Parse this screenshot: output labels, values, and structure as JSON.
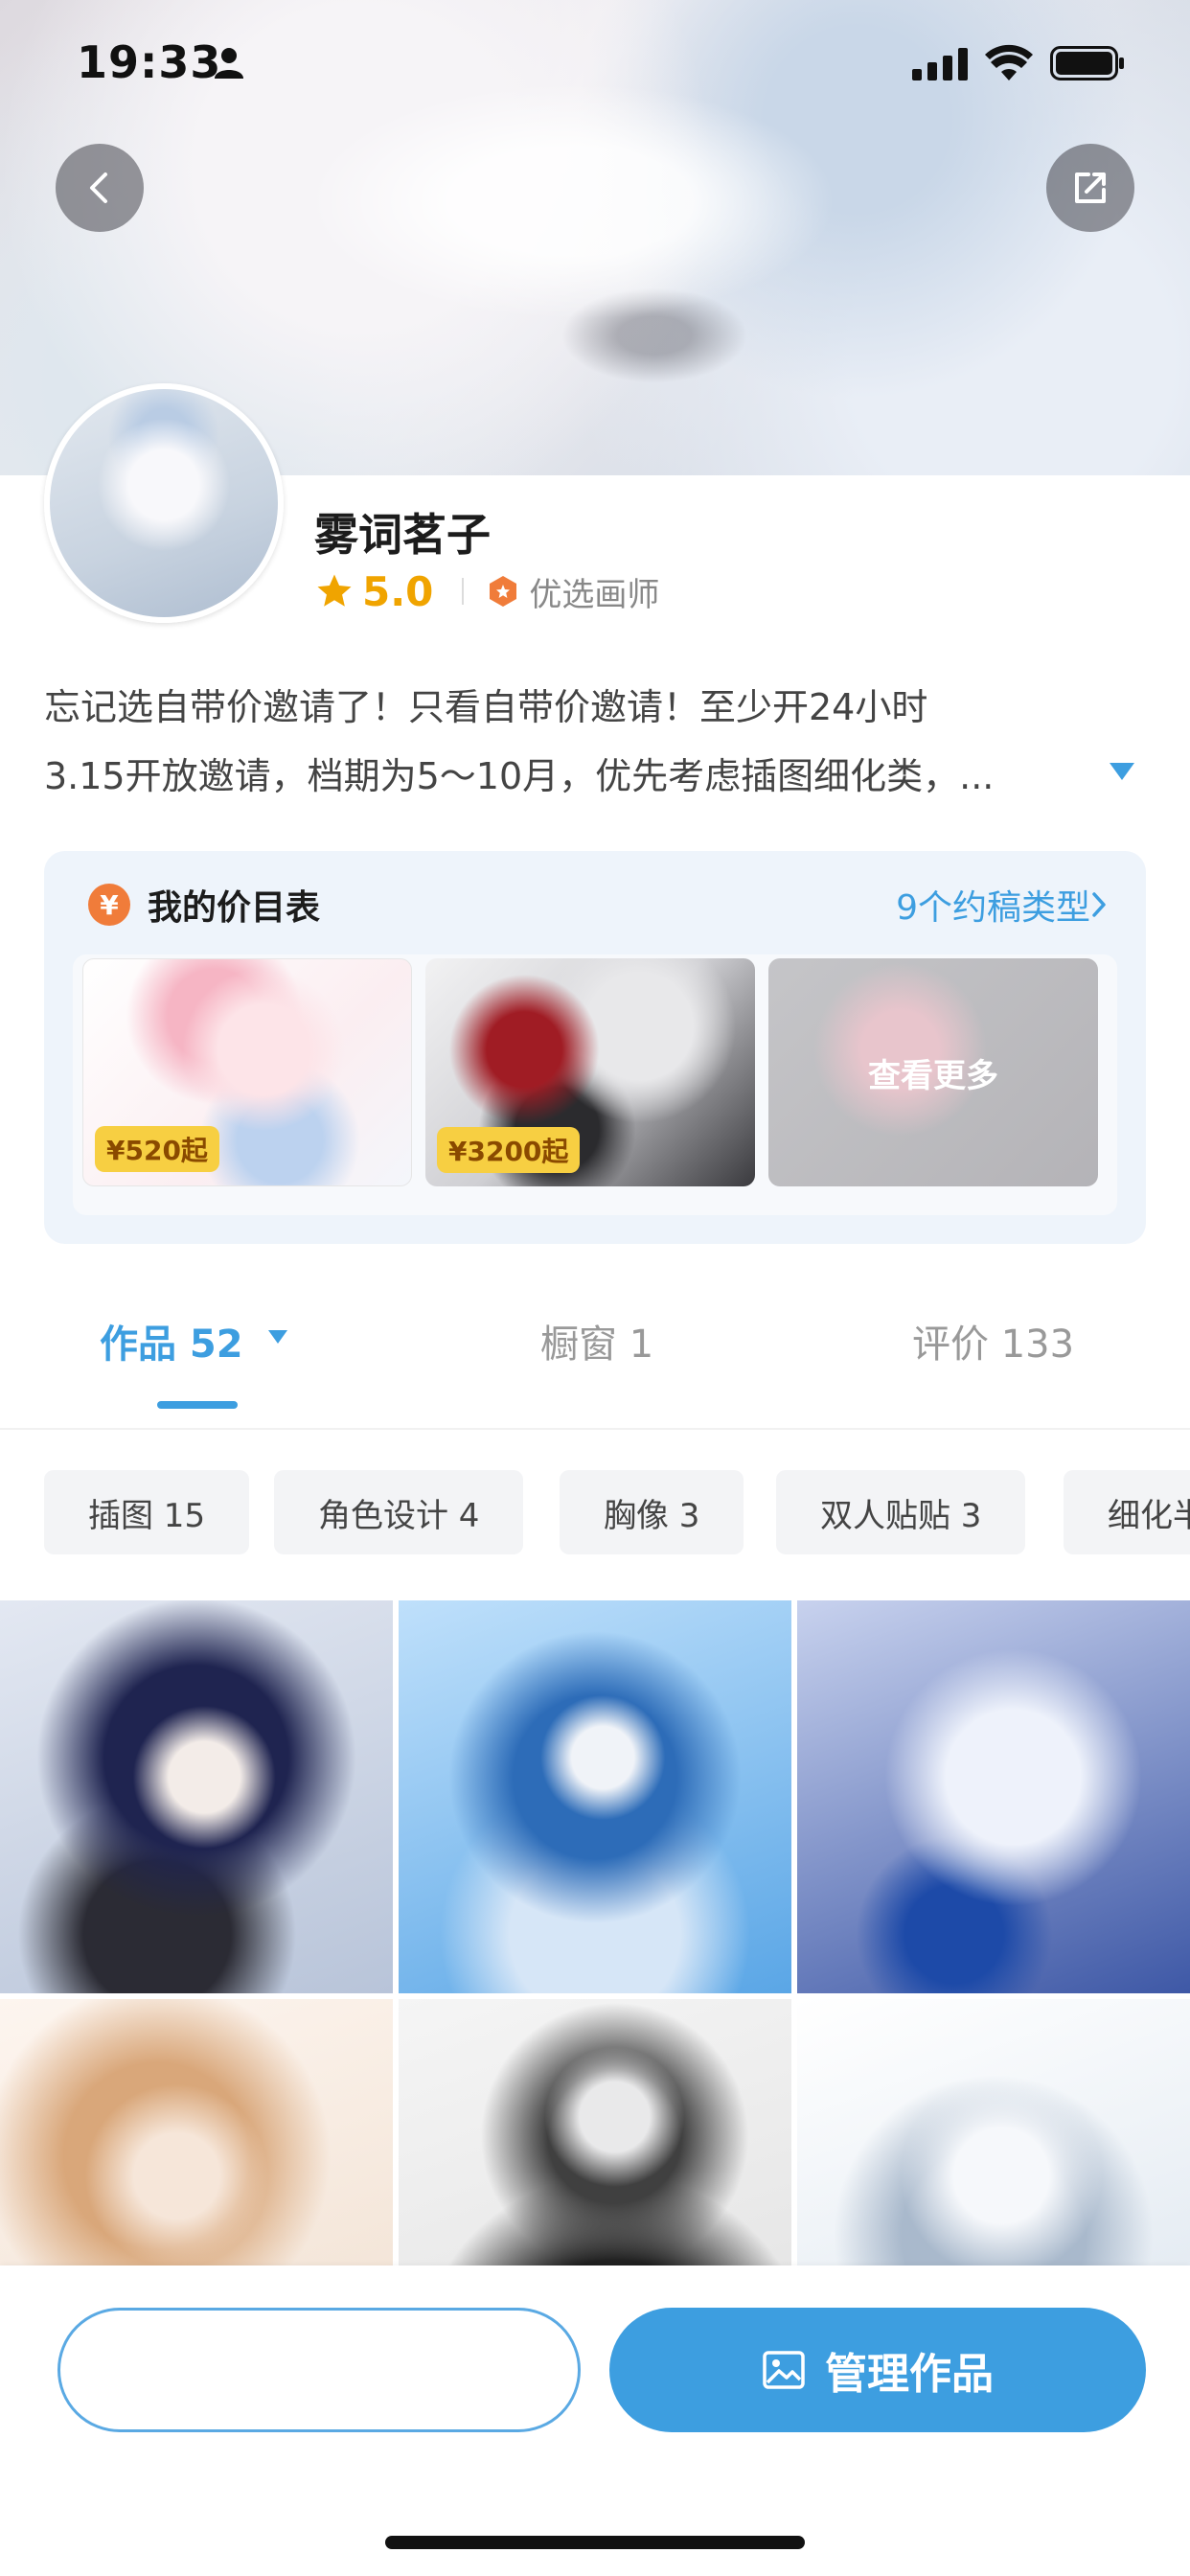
{
  "status_bar": {
    "time": "19:33"
  },
  "profile": {
    "name": "雾词茗子",
    "rating": "5.0",
    "badge": "优选画师",
    "bio_lines": [
      "忘记选自带价邀请了！只看自带价邀请！至少开24小时",
      "3.15开放邀请，档期为5～10月，优先考虑插图细化类，..."
    ]
  },
  "price_list": {
    "icon_glyph": "¥",
    "title": "我的价目表",
    "link": "9个约稿类型",
    "items": [
      {
        "price": "¥520起"
      },
      {
        "price": "¥3200起"
      }
    ],
    "see_more": "查看更多"
  },
  "tabs": {
    "works": "作品 52",
    "showcase": "橱窗 1",
    "reviews": "评价 133"
  },
  "chips": [
    "插图 15",
    "角色设计 4",
    "胸像 3",
    "双人贴贴 3",
    "细化半身"
  ],
  "bottom": {
    "primary_label": "管理作品"
  },
  "icons": {
    "back": "chevron-left-icon",
    "share": "share-icon",
    "star": "star-icon",
    "badge": "badge-icon",
    "expand": "triangle-down-icon",
    "image": "image-icon"
  },
  "colors": {
    "accent": "#3d9ee0",
    "rating": "#f0a400",
    "price_tag": "#f7cf42"
  }
}
